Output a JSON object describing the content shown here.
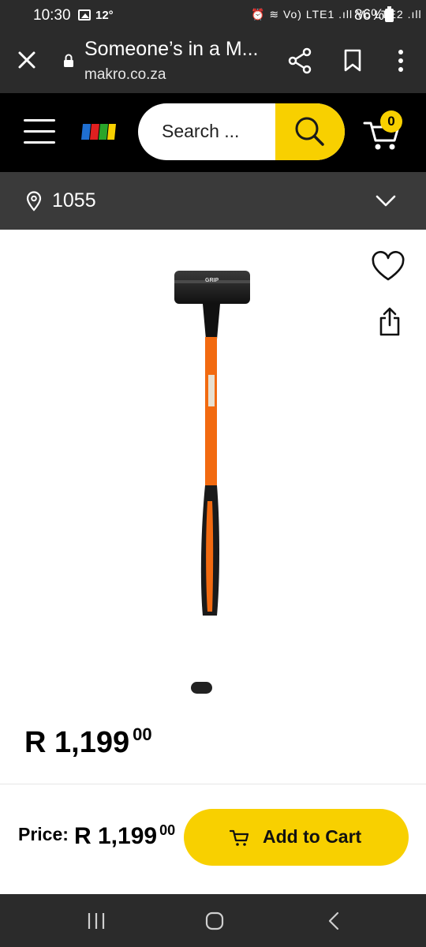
{
  "status_bar": {
    "time": "10:30",
    "temperature": "12°",
    "network_indicators": "⏰ ≋ Vo) LTE1 .ıll Vo LTE2 .ıll",
    "battery_percent": "86%"
  },
  "browser": {
    "page_title": "Someone’s in a M...",
    "url": "makro.co.za",
    "icons": [
      "close-icon",
      "lock-icon",
      "share-icon",
      "bookmark-icon",
      "more-vert-icon"
    ]
  },
  "header": {
    "search_placeholder": "Search ...",
    "cart_count": "0",
    "logo_colors": [
      "#1f6fd1",
      "#e02020",
      "#2aa52a",
      "#f8d000"
    ],
    "accent_color": "#f8d000"
  },
  "location": {
    "code": "1055"
  },
  "product": {
    "image_description_icon": "sledgehammer-image",
    "head_brand_text": "GRIP",
    "price_integer": "R 1,199",
    "price_cents": "00"
  },
  "action_bar": {
    "price_label": "Price:",
    "price_integer": "R 1,199",
    "price_cents": "00",
    "add_to_cart_label": "Add to Cart"
  }
}
